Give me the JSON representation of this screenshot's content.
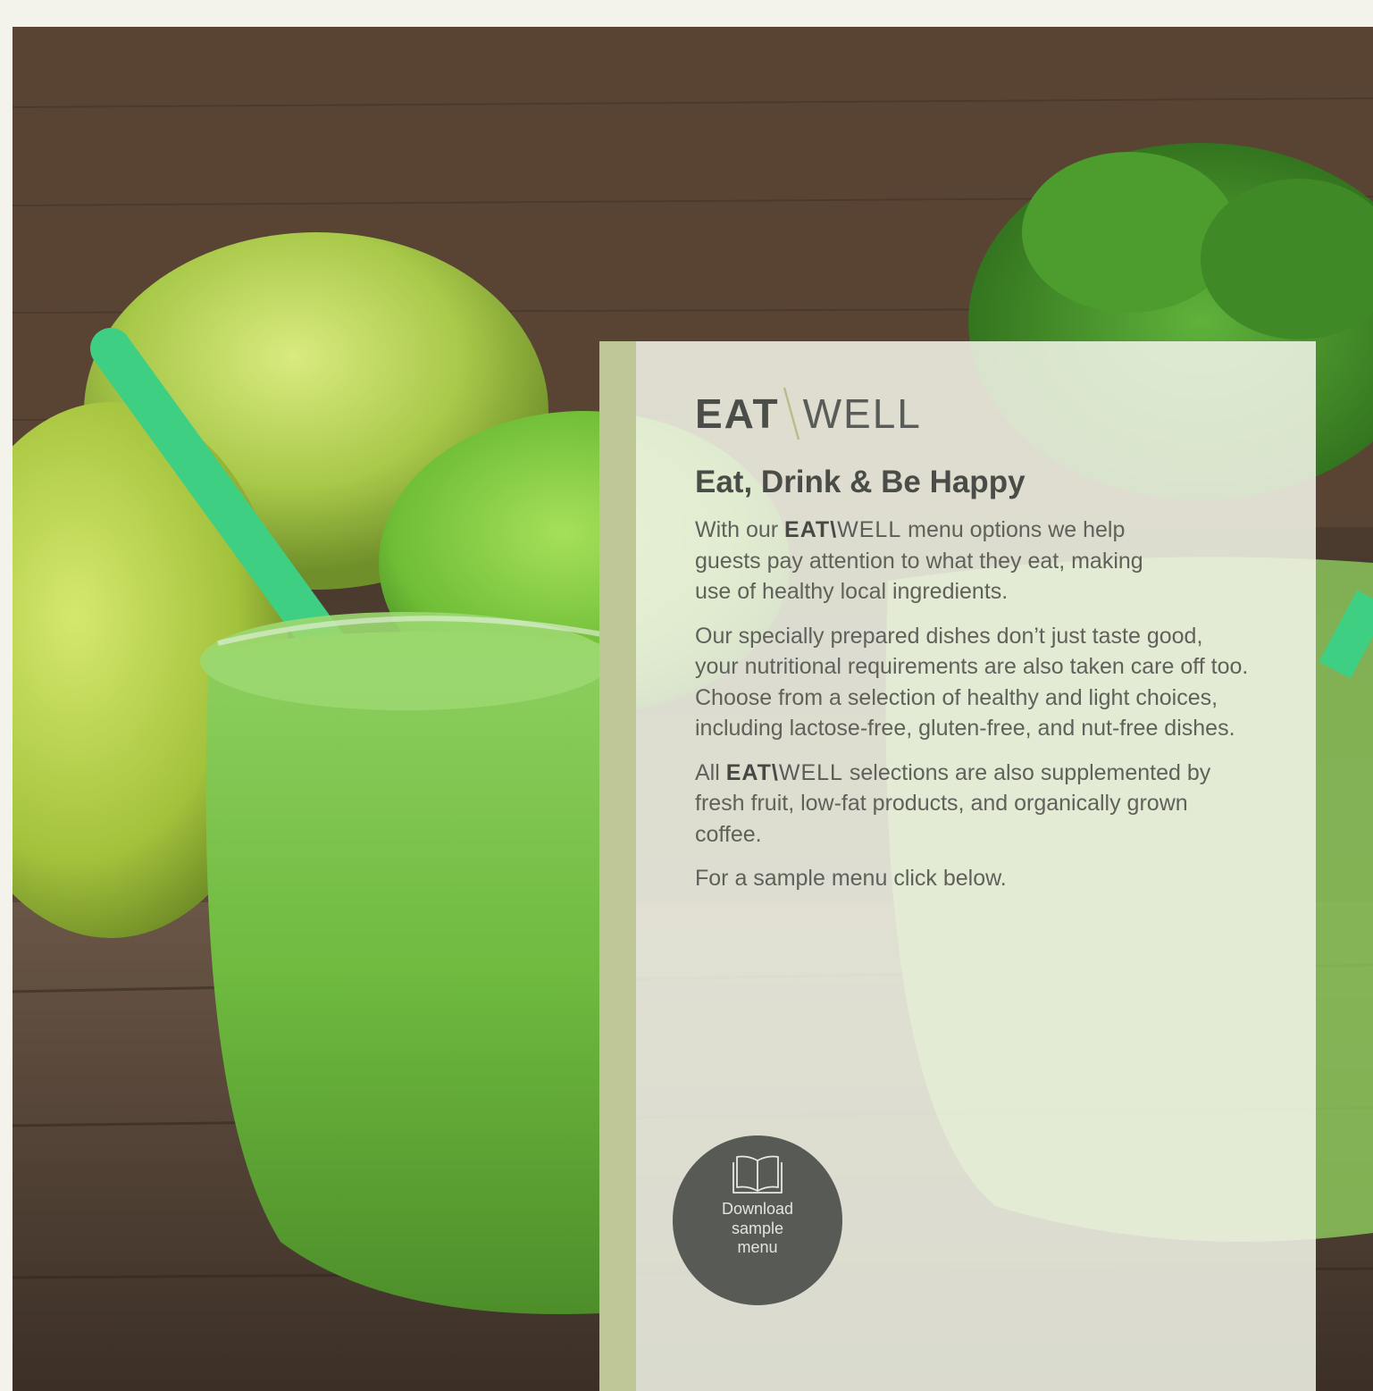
{
  "hero": {
    "image_alt": "green smoothie with apples and herbs",
    "icon": "hero-photo"
  },
  "logo": {
    "part1": "EAT",
    "part2": "WELL"
  },
  "headline": "Eat, Drink & Be Happy",
  "paragraphs": {
    "p1_before": "With our ",
    "p1_brand_a": "EAT",
    "p1_brand_b": "WELL",
    "p1_after": " menu options we help guests pay attention to what they eat, making use of healthy local ingredients.",
    "p2": "Our specially prepared dishes don’t just taste good, your nutritional requirements are also taken care off too. Choose from a selection of healthy and light choices, including lactose-free, gluten-free, and nut-free dishes.",
    "p3_before": "All ",
    "p3_brand_a": "EAT",
    "p3_brand_b": "WELL",
    "p3_after": " selections are also supplemented by fresh fruit, low-fat products, and organically grown coffee.",
    "p4": "For a sample menu click below."
  },
  "download": {
    "line1": "Download",
    "line2": "sample",
    "line3": "menu",
    "icon": "open-book-icon"
  },
  "colors": {
    "accent": "#c0c796",
    "button": "#585a56",
    "text": "#4a4c48"
  }
}
